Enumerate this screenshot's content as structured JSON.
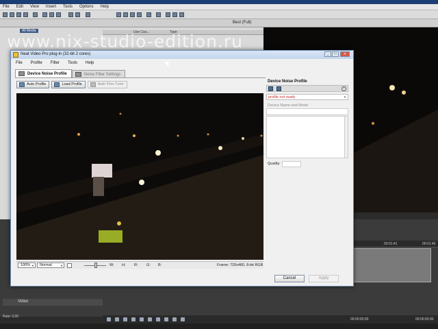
{
  "watermark": "www.nix-studio-edition.ru",
  "host": {
    "menu": [
      "File",
      "Edit",
      "View",
      "Insert",
      "Tools",
      "Options",
      "Help"
    ],
    "all_media_label": "All Media",
    "col_name": "Use Cou...",
    "col_type": "Type",
    "preview_quality": "Best (Full)",
    "timeline_markers": [
      "00:01:41",
      "00:01:45"
    ],
    "track_label": "Video",
    "rate_label": "Rate: 0,00",
    "timecode_1": "00:00:00;00",
    "timecode_2": "00:00:00;00"
  },
  "dialog": {
    "title": "Neat Video Pro plug-in (32-bit 2 cores)",
    "menu": [
      "File",
      "Profile",
      "Filter",
      "Tools",
      "Help"
    ],
    "tabs": [
      {
        "label": "Device Noise Profile",
        "active": true
      },
      {
        "label": "Noise Filter Settings",
        "active": false
      }
    ],
    "buttons": {
      "auto_profile": "Auto Profile",
      "load_profile": "Load Profile",
      "auto_fine_tune": "Auto Fine-Tune"
    },
    "bottom": {
      "zoom": "100%",
      "mode": "Normal",
      "w_label": "W:",
      "h_label": "H:",
      "r_label": "R:",
      "g_label": "G:",
      "b_label": "B:",
      "frame_info": "Frame: 720x480, 8-bit RGB"
    },
    "right_panel": {
      "title": "Device Noise Profile",
      "status": "profile not ready",
      "device_label": "Device Name and Mode:",
      "quality_label": "Quality:"
    },
    "cancel_label": "Cancel",
    "apply_label": "Apply"
  },
  "colors": {
    "accent": "#1b3f74",
    "status_error": "#c63030"
  }
}
